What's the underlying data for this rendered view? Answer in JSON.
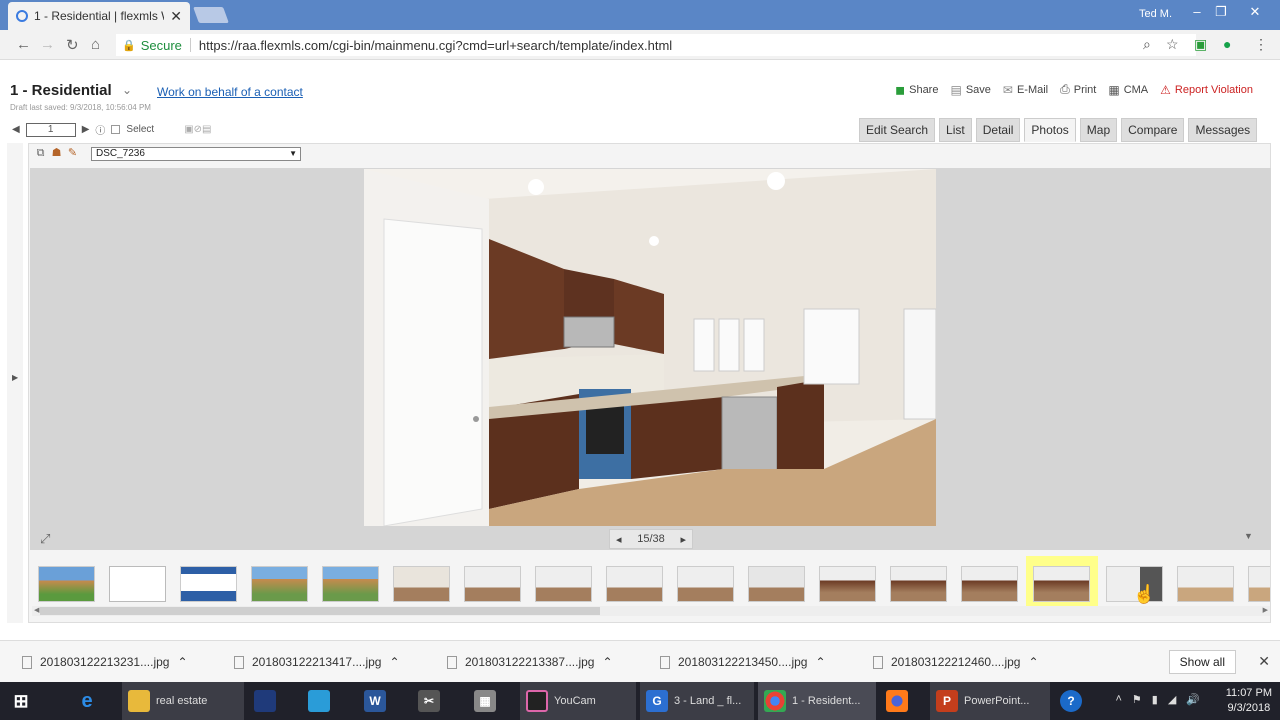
{
  "browser": {
    "tab_title": "1 - Residential | flexmls W",
    "user": "Ted M.",
    "secure_label": "Secure",
    "url": "https://raa.flexmls.com/cgi-bin/mainmenu.cgi?cmd=url+search/template/index.html"
  },
  "page": {
    "title": "1 - Residential",
    "behalf_link": "Work on behalf of a contact",
    "draft": "Draft last saved: 9/3/2018, 10:56:04 PM",
    "actions": [
      {
        "label": "Share",
        "icon": "share-icon",
        "color": "#2a9d3a"
      },
      {
        "label": "Save",
        "icon": "save-icon",
        "color": "#888"
      },
      {
        "label": "E-Mail",
        "icon": "email-icon",
        "color": "#888"
      },
      {
        "label": "Print",
        "icon": "printer-icon",
        "color": "#555"
      },
      {
        "label": "CMA",
        "icon": "cma-icon",
        "color": "#555"
      },
      {
        "label": "Report Violation",
        "icon": "warning-icon",
        "color": "#cc2222"
      }
    ],
    "pager_value": "1",
    "select_label": "Select",
    "view_tabs": [
      "Edit Search",
      "List",
      "Detail",
      "Photos",
      "Map",
      "Compare",
      "Messages"
    ],
    "active_tab": "Photos",
    "photo_select": "DSC_7236",
    "photo_counter": "15/38"
  },
  "downloads": {
    "files": [
      "201803122213231....jpg",
      "201803122213417....jpg",
      "201803122213387....jpg",
      "201803122213450....jpg",
      "201803122212460....jpg"
    ],
    "show_all": "Show all"
  },
  "taskbar": {
    "apps": [
      "real estate",
      "YouCam",
      "3 - Land _ fl...",
      "1 - Resident...",
      "PowerPoint..."
    ],
    "time": "11:07 PM",
    "date": "9/3/2018"
  }
}
